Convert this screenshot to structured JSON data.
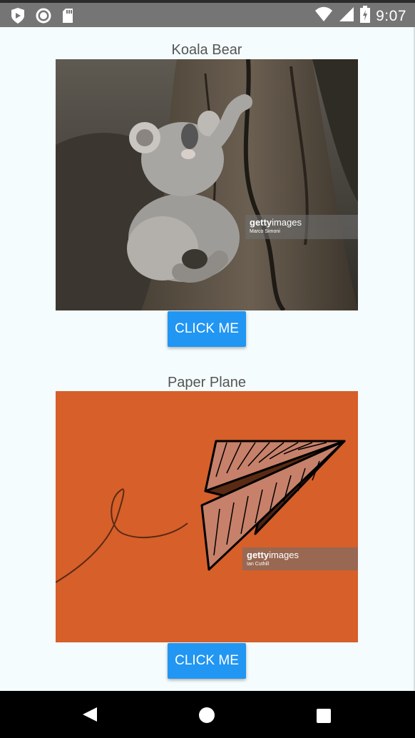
{
  "status_bar": {
    "time": "9:07",
    "icons_left": [
      "play-shield-icon",
      "record-circle-icon",
      "sd-card-icon"
    ],
    "icons_right": [
      "wifi-icon",
      "signal-icon",
      "battery-charging-icon"
    ]
  },
  "cards": [
    {
      "title": "Koala Bear",
      "button_label": "CLICK ME",
      "watermark": {
        "brand_bold": "getty",
        "brand_rest": "images",
        "credit": "Marco Simoni"
      }
    },
    {
      "title": "Paper Plane",
      "button_label": "CLICK ME",
      "watermark": {
        "brand_bold": "getty",
        "brand_rest": "images",
        "credit": "Ian Cuthill"
      }
    }
  ],
  "colors": {
    "background": "#f5fcfd",
    "button": "#2196f3",
    "status_bar": "#757575",
    "plane_bg": "#d65f2a",
    "nav_bar": "#000000"
  },
  "nav_bar": {
    "icons": [
      "back-icon",
      "home-icon",
      "recents-icon"
    ]
  }
}
